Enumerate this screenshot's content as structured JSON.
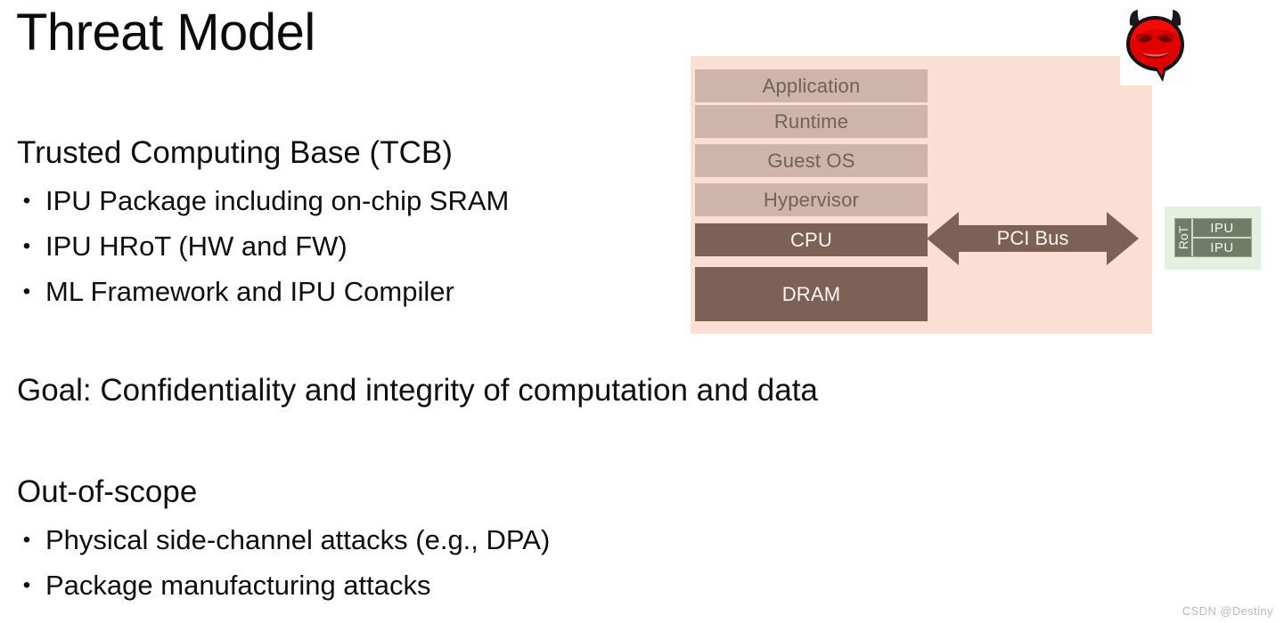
{
  "slide": {
    "title": "Threat Model",
    "watermark": "CSDN @Destiny"
  },
  "tcb": {
    "heading": "Trusted Computing Base (TCB)",
    "bullet_glyph": "•",
    "items": [
      "IPU Package including on-chip SRAM",
      "IPU HRoT (HW and FW)",
      "ML Framework and IPU Compiler"
    ]
  },
  "goal": {
    "text": "Goal: Confidentiality and integrity of computation and data"
  },
  "out_of_scope": {
    "heading": "Out-of-scope",
    "bullet_glyph": "•",
    "items": [
      "Physical side-channel attacks (e.g., DPA)",
      "Package manufacturing attacks"
    ]
  },
  "diagram": {
    "host_stack": [
      {
        "label": "Application",
        "trust": "untrusted"
      },
      {
        "label": "Runtime",
        "trust": "untrusted"
      },
      {
        "label": "Guest OS",
        "trust": "untrusted"
      },
      {
        "label": "Hypervisor",
        "trust": "untrusted"
      },
      {
        "label": "CPU",
        "trust": "untrusted-dark"
      },
      {
        "label": "DRAM",
        "trust": "untrusted-dark"
      }
    ],
    "interconnect": {
      "label": "PCI Bus",
      "icon": "double-arrow-icon"
    },
    "attacker": {
      "icon": "devil-face-icon"
    },
    "accelerator": {
      "rot_label": "RoT",
      "ipu_labels": [
        "IPU",
        "IPU"
      ]
    },
    "colors": {
      "host_panel_bg": "#fbdfd4",
      "box_light": "#cfb4aa",
      "box_light_text": "#70625a",
      "box_dark": "#7d6157",
      "box_dark_text": "#fdf4f0",
      "accelerator_panel_bg": "#e6f0e1",
      "accelerator_chip": "#6f7c66",
      "accelerator_chip_text": "#f2f6ef",
      "attacker_red": "#e00000"
    }
  }
}
